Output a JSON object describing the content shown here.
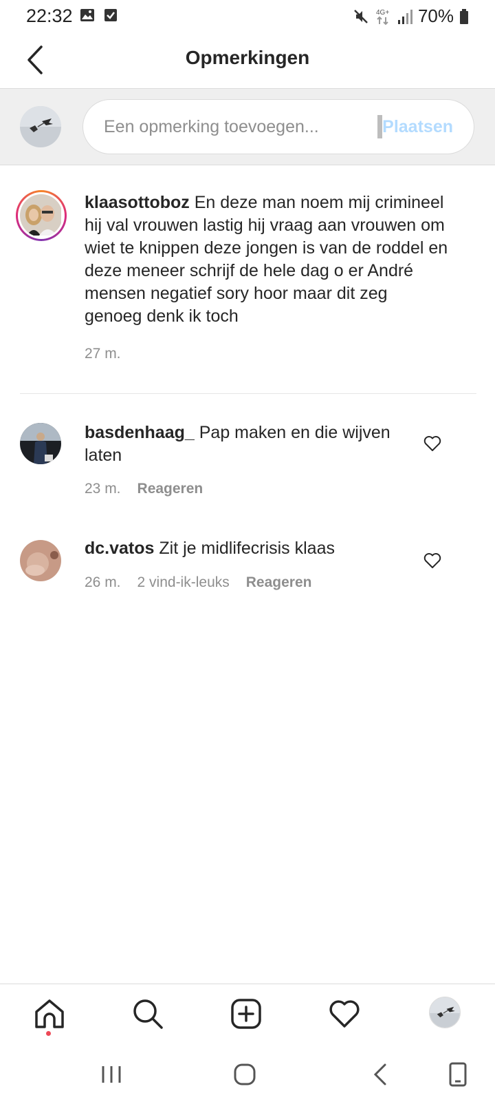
{
  "status_bar": {
    "time": "22:32",
    "left_icons": [
      "image-icon",
      "checkbox-icon"
    ],
    "right_icons": [
      "mute-icon",
      "4g-icon",
      "signal-icon",
      "battery-icon"
    ],
    "battery": "70%"
  },
  "header": {
    "title": "Opmerkingen",
    "back_icon": "back-arrow-icon"
  },
  "composer": {
    "placeholder": "Een opmerking toevoegen...",
    "post_label": "Plaatsen"
  },
  "caption": {
    "username": "klaasottoboz",
    "text": "En deze man noem mij crimineel hij val vrouwen lastig hij vraag aan vrouwen om wiet te knippen deze jongen is van de roddel en deze meneer schrijf de hele dag o er André mensen negatief sory hoor maar dit zeg genoeg denk ik toch",
    "time": "27 m."
  },
  "comments": [
    {
      "username": "basdenhaag_",
      "text": "Pap maken en die wijven laten",
      "time": "23 m.",
      "likes": "",
      "reply_label": "Reageren"
    },
    {
      "username": "dc.vatos",
      "text": "Zit je midlifecrisis klaas",
      "time": "26 m.",
      "likes": "2 vind-ik-leuks",
      "reply_label": "Reageren"
    }
  ],
  "bottom_nav": [
    "home-icon",
    "search-icon",
    "add-post-icon",
    "activity-heart-icon",
    "profile-avatar"
  ],
  "system_nav": [
    "recent-apps-icon",
    "home-circle-icon",
    "system-back-icon",
    "screen-rotate-icon"
  ],
  "colors": {
    "post_button": "#b3dbff",
    "notification_dot": "#ed4956",
    "secondary_text": "#8e8e8e",
    "primary_text": "#262626"
  }
}
